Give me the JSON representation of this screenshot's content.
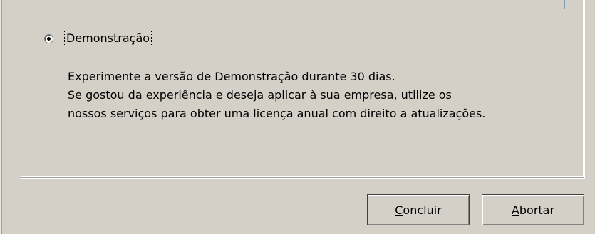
{
  "license_option": {
    "label": "Demonstração",
    "selected": true,
    "description_lines": [
      "Experimente a versão de Demonstração durante 30 dias.",
      "Se gostou da experiência e deseja aplicar à sua empresa, utilize os",
      "nossos serviços para obter uma licença anual com direito a atualizações."
    ]
  },
  "buttons": {
    "finish": {
      "mnemonic": "C",
      "rest": "oncluir"
    },
    "abort": {
      "mnemonic": "A",
      "rest": "bortar"
    }
  },
  "colors": {
    "window_bg": "#d4d0c8",
    "field_border": "#7f9db9"
  }
}
